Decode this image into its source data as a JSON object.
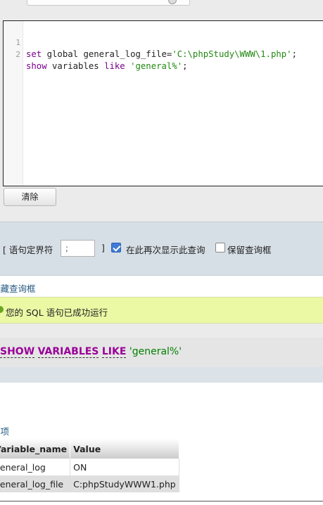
{
  "editor": {
    "lines": [
      {
        "number": "1",
        "tokens": [
          {
            "t": "set",
            "c": "kw"
          },
          {
            "t": " global general_log_file=",
            "c": "plain"
          },
          {
            "t": "'C:\\phpStudy\\WWW\\1.php'",
            "c": "str"
          },
          {
            "t": ";",
            "c": "plain"
          }
        ]
      },
      {
        "number": "2",
        "tokens": [
          {
            "t": "show",
            "c": "kw"
          },
          {
            "t": " variables ",
            "c": "plain"
          },
          {
            "t": "like",
            "c": "kw"
          },
          {
            "t": " ",
            "c": "plain"
          },
          {
            "t": "'general%'",
            "c": "str"
          },
          {
            "t": ";",
            "c": "plain"
          }
        ]
      }
    ]
  },
  "clear_button": "清除",
  "options": {
    "delimiter_label": "[ 语句定界符",
    "delimiter_value": ";",
    "delimiter_close": "]",
    "show_again_label": "在此再次显示此查询",
    "show_again_checked": true,
    "retain_box_label": "保留查询框",
    "retain_box_checked": false
  },
  "hide_query_link": "隐藏查询框",
  "success_message": "您的 SQL 语句已成功运行",
  "sql": {
    "kw1": "SHOW",
    "kw2": "VARIABLES",
    "kw3": "LIKE",
    "string": "'general%'"
  },
  "options_link": "选项",
  "table": {
    "headers": [
      "Variable_name",
      "Value"
    ],
    "rows": [
      [
        "general_log",
        "ON"
      ],
      [
        "general_log_file",
        "C:phpStudyWWW1.php"
      ]
    ]
  },
  "colors": {
    "keyword": "#770088",
    "string": "#228811",
    "sql_keyword": "#990099",
    "success_bg": "#ebf8a4",
    "link": "#235a81"
  }
}
